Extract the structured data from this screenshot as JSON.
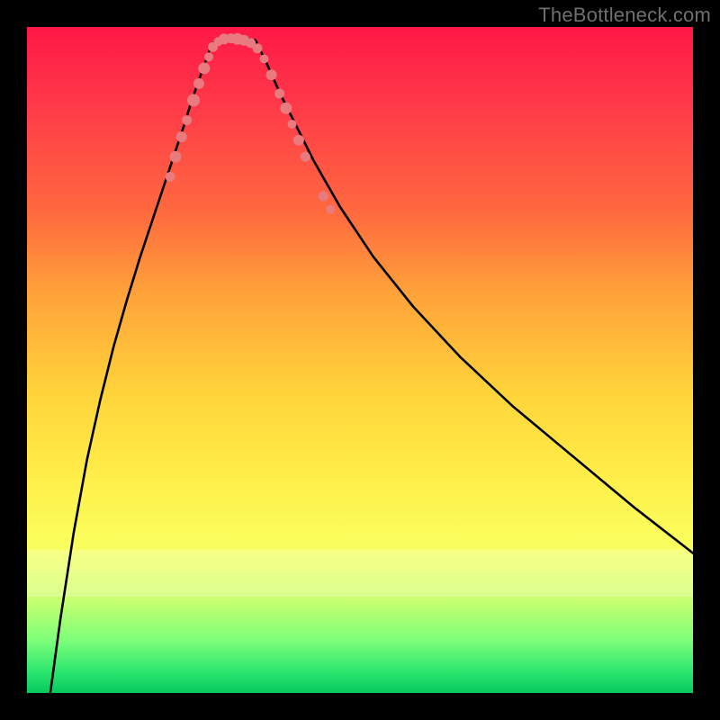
{
  "watermark": "TheBottleneck.com",
  "colors": {
    "page_bg": "#000000",
    "gradient_top": "#ff1846",
    "gradient_bottom": "#08c85e",
    "curve": "#000000",
    "dots": "#e97a7e",
    "watermark_text": "#6f6f6f"
  },
  "chart_data": {
    "type": "line",
    "title": "",
    "xlabel": "",
    "ylabel": "",
    "xlim": [
      0,
      100
    ],
    "ylim": [
      0,
      100
    ],
    "grid": false,
    "legend": false,
    "note": "values are percent within the 740×740 plot area; y shown = 100 - y-from-top",
    "series": [
      {
        "name": "left-branch",
        "x": [
          3.5,
          5,
          7,
          9,
          11,
          13,
          15,
          17,
          19,
          20.5,
          22,
          23.5,
          24.6,
          25.8,
          26.8,
          27.6,
          28.5
        ],
        "y": [
          0,
          11,
          24,
          35,
          44,
          52,
          59,
          65.5,
          71.5,
          76,
          80.5,
          85,
          88.5,
          92,
          94.8,
          97,
          98.2
        ]
      },
      {
        "name": "flat-bottom",
        "x": [
          28.5,
          30.0,
          31.5,
          33.0,
          34.3
        ],
        "y": [
          98.2,
          98.4,
          98.4,
          98.3,
          98.0
        ]
      },
      {
        "name": "right-branch",
        "x": [
          34.3,
          36,
          38,
          40,
          43,
          47,
          52,
          58,
          65,
          73,
          82,
          91,
          100
        ],
        "y": [
          98.0,
          94.5,
          90,
          86,
          80,
          73,
          65.5,
          58,
          50.5,
          43,
          35.5,
          28,
          21
        ]
      }
    ],
    "markers": [
      {
        "name": "left-cluster",
        "points": [
          {
            "x": 21.5,
            "y": 77.5,
            "r": 5.5
          },
          {
            "x": 22.3,
            "y": 80.5,
            "r": 6.5
          },
          {
            "x": 23.2,
            "y": 83.5,
            "r": 6.0
          },
          {
            "x": 24.0,
            "y": 86.0,
            "r": 5.5
          },
          {
            "x": 25.0,
            "y": 89.0,
            "r": 7.0
          },
          {
            "x": 25.8,
            "y": 91.5,
            "r": 6.0
          },
          {
            "x": 26.6,
            "y": 93.8,
            "r": 6.5
          },
          {
            "x": 27.3,
            "y": 95.5,
            "r": 5.0
          },
          {
            "x": 27.9,
            "y": 97.0,
            "r": 5.5
          }
        ]
      },
      {
        "name": "bottom-cluster",
        "points": [
          {
            "x": 28.7,
            "y": 97.8,
            "r": 5.0
          },
          {
            "x": 29.6,
            "y": 98.2,
            "r": 6.0
          },
          {
            "x": 30.6,
            "y": 98.3,
            "r": 5.5
          },
          {
            "x": 31.6,
            "y": 98.2,
            "r": 6.5
          },
          {
            "x": 32.6,
            "y": 98.0,
            "r": 6.0
          },
          {
            "x": 33.6,
            "y": 97.6,
            "r": 5.5
          },
          {
            "x": 34.6,
            "y": 96.8,
            "r": 5.5
          }
        ]
      },
      {
        "name": "right-lower",
        "points": [
          {
            "x": 35.6,
            "y": 95.2,
            "r": 5.0
          },
          {
            "x": 36.7,
            "y": 92.8,
            "r": 6.0
          },
          {
            "x": 37.9,
            "y": 90.0,
            "r": 5.5
          },
          {
            "x": 38.9,
            "y": 87.8,
            "r": 6.5
          },
          {
            "x": 39.8,
            "y": 85.4,
            "r": 5.0
          },
          {
            "x": 40.8,
            "y": 83.0,
            "r": 6.0
          },
          {
            "x": 41.8,
            "y": 80.5,
            "r": 5.5
          }
        ]
      },
      {
        "name": "right-upper-gap-cluster",
        "points": [
          {
            "x": 44.5,
            "y": 74.6,
            "r": 5.5
          },
          {
            "x": 45.6,
            "y": 72.6,
            "r": 5.0
          }
        ]
      }
    ]
  }
}
